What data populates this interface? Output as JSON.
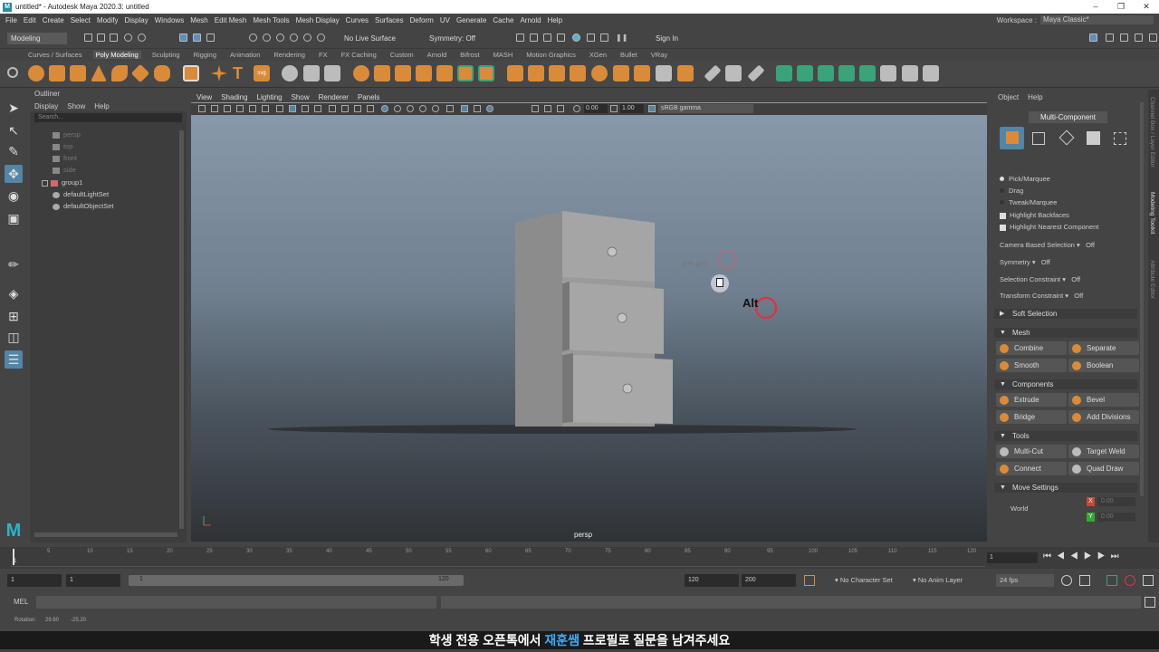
{
  "titlebar": {
    "title": "untitled* - Autodesk Maya 2020.3: untitled",
    "logo": "M"
  },
  "menubar": {
    "items": [
      "File",
      "Edit",
      "Create",
      "Select",
      "Modify",
      "Display",
      "Windows",
      "Mesh",
      "Edit Mesh",
      "Mesh Tools",
      "Mesh Display",
      "Curves",
      "Surfaces",
      "Deform",
      "UV",
      "Generate",
      "Cache",
      "Arnold",
      "Help"
    ],
    "workspace_label": "Workspace :",
    "workspace_value": "Maya Classic*"
  },
  "statusline": {
    "mode": "Modeling",
    "live_surface": "No Live Surface",
    "symmetry": "Symmetry: Off",
    "sign_in": "Sign In"
  },
  "shelf": {
    "tabs": [
      "Curves / Surfaces",
      "Poly Modeling",
      "Sculpting",
      "Rigging",
      "Animation",
      "Rendering",
      "FX",
      "FX Caching",
      "Custom",
      "Arnold",
      "Bifrost",
      "MASH",
      "Motion Graphics",
      "XGen",
      "Bullet",
      "VRay"
    ],
    "active_tab": "Poly Modeling"
  },
  "outliner": {
    "title": "Outliner",
    "menus": [
      "Display",
      "Show",
      "Help"
    ],
    "search_placeholder": "Search...",
    "items": [
      {
        "label": "persp",
        "dim": true
      },
      {
        "label": "top",
        "dim": true
      },
      {
        "label": "front",
        "dim": true
      },
      {
        "label": "side",
        "dim": true
      },
      {
        "label": "group1",
        "dim": false
      },
      {
        "label": "defaultLightSet",
        "dim": false
      },
      {
        "label": "defaultObjectSet",
        "dim": false
      }
    ]
  },
  "viewport": {
    "menus": [
      "View",
      "Shading",
      "Lighting",
      "Show",
      "Renderer",
      "Panels"
    ],
    "exposure": "0.00",
    "gamma": "1.00",
    "color_space": "sRGB gamma",
    "camera": "persp",
    "overlay_text": "왼쪽 클릭",
    "overlay_key": "Alt"
  },
  "rightpanel": {
    "menus": [
      "Object",
      "Help"
    ],
    "component_mode": "Multi-Component",
    "pick_options": [
      "Pick/Marquee",
      "Drag",
      "Tweak/Marquee"
    ],
    "checks": [
      "Highlight Backfaces",
      "Highlight Nearest Component"
    ],
    "settings": [
      {
        "label": "Camera Based Selection",
        "value": "Off"
      },
      {
        "label": "Symmetry",
        "value": "Off"
      },
      {
        "label": "Selection Constraint",
        "value": "Off"
      },
      {
        "label": "Transform Constraint",
        "value": "Off"
      }
    ],
    "soft_selection": "Soft Selection",
    "sections": {
      "mesh": {
        "title": "Mesh",
        "buttons": [
          "Combine",
          "Separate",
          "Smooth",
          "Boolean"
        ]
      },
      "components": {
        "title": "Components",
        "buttons": [
          "Extrude",
          "Bevel",
          "Bridge",
          "Add Divisions"
        ]
      },
      "tools": {
        "title": "Tools",
        "buttons": [
          "Multi-Cut",
          "Target Weld",
          "Connect",
          "Quad Draw"
        ]
      },
      "move": {
        "title": "Move Settings",
        "space": "World",
        "axes": [
          "X",
          "Y"
        ],
        "values": [
          "0.00",
          "0.00"
        ]
      }
    },
    "side_tabs": [
      "Channel Box / Layer Editor",
      "Modeling Toolkit",
      "Attribute Editor"
    ]
  },
  "timeline": {
    "ticks": [
      "1",
      "5",
      "10",
      "15",
      "20",
      "25",
      "30",
      "35",
      "40",
      "45",
      "50",
      "55",
      "60",
      "65",
      "70",
      "75",
      "80",
      "85",
      "90",
      "95",
      "100",
      "105",
      "110",
      "115",
      "120"
    ],
    "current_frame": "1"
  },
  "range": {
    "start": "1",
    "start_inner": "1",
    "slider_start": "1",
    "slider_end": "120",
    "end_inner": "120",
    "end": "200",
    "character_set": "No Character Set",
    "anim_layer": "No Anim Layer",
    "fps": "24 fps"
  },
  "mel": {
    "label": "MEL"
  },
  "helpline": {
    "label": "Rotation:",
    "v1": "29.60",
    "v2": "-25.20"
  },
  "caption": {
    "pre": "학생 전용 오픈톡에서 ",
    "highlight": "재훈쌤",
    "post": " 프로필로 질문을 남겨주세요"
  },
  "colors": {
    "accent_orange": "#d98b3a",
    "accent_green": "#3aa37a",
    "caption_highlight": "#3fa9f5"
  }
}
